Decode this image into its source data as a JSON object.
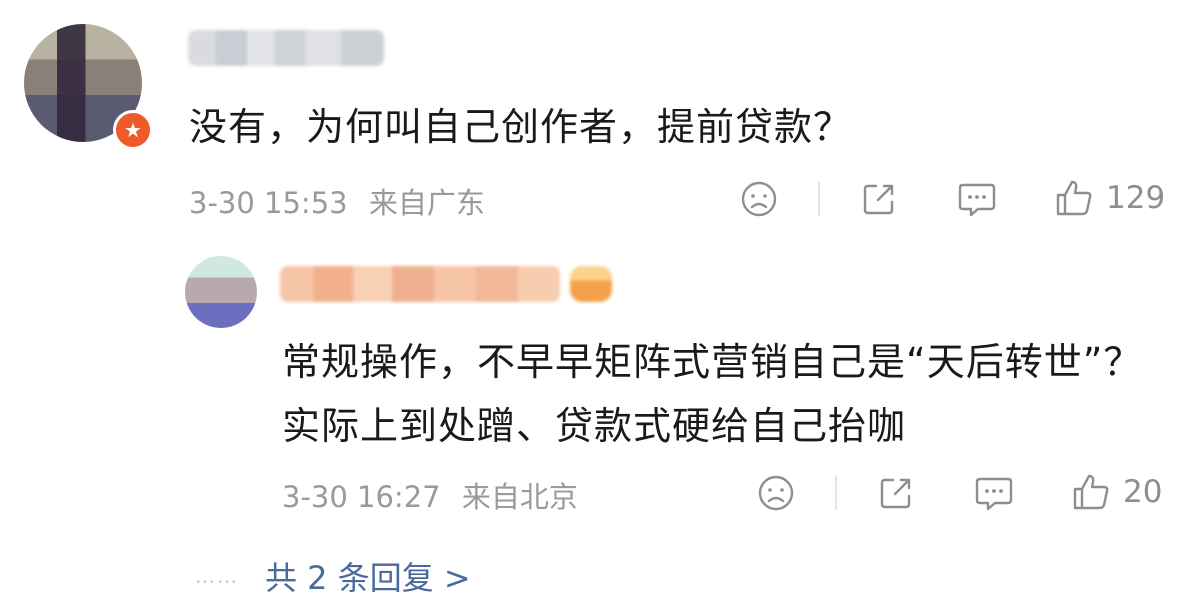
{
  "main_comment": {
    "badge_icon": "star-badge-icon",
    "text": "没有，为何叫自己创作者，提前贷款？",
    "date": "3-30 15:53",
    "location": "来自广东",
    "like_count": "129"
  },
  "reply": {
    "text": "常规操作，不早早矩阵式营销自己是“天后转世”？实际上到处蹭、贷款式硬给自己抬咖",
    "date": "3-30 16:27",
    "location": "来自北京",
    "like_count": "20"
  },
  "more_replies": {
    "dots": "……",
    "label": "共 2 条回复 >"
  },
  "icons": {
    "dislike": "sad-face-icon",
    "share": "share-icon",
    "comment": "comment-icon",
    "like": "thumbs-up-icon"
  },
  "colors": {
    "text": "#1a1a1a",
    "meta": "#9a9a9a",
    "link": "#4a6a9a",
    "badge": "#ee5a2a"
  }
}
